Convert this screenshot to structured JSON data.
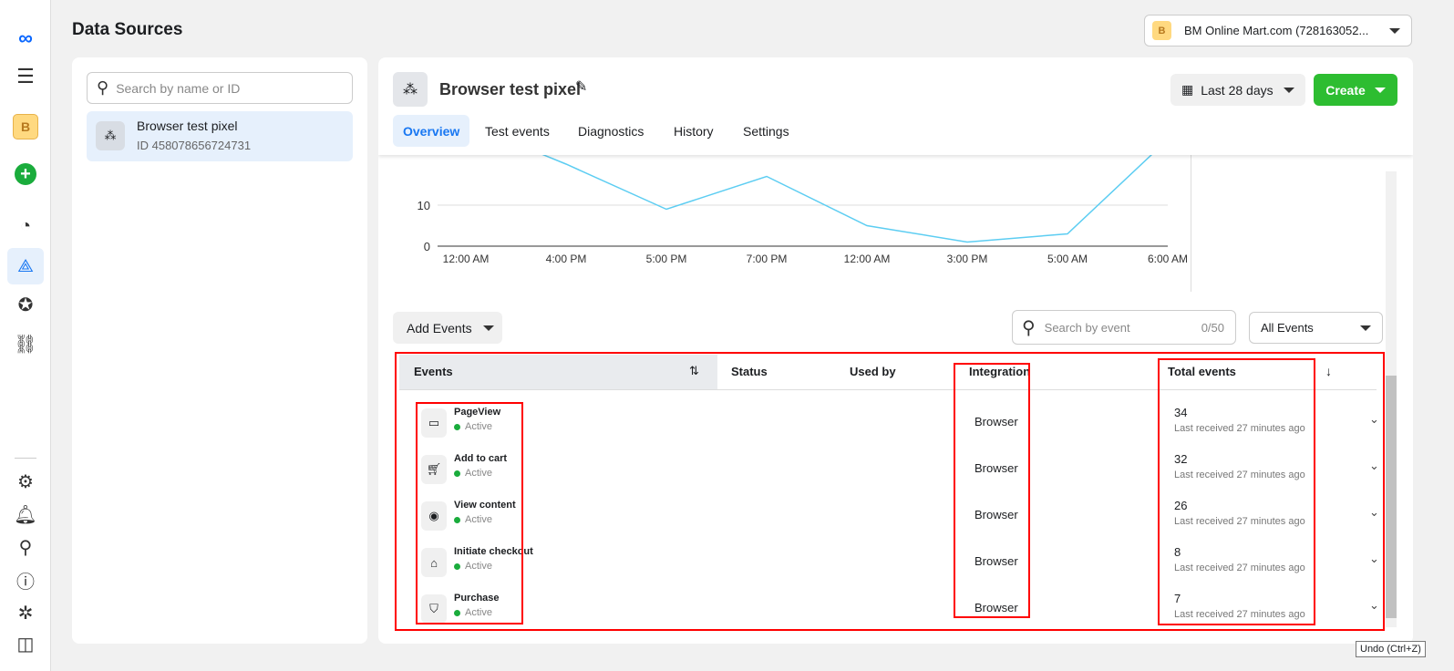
{
  "page": {
    "title": "Data Sources"
  },
  "account": {
    "initial": "B",
    "name": "BM Online Mart.com (728163052..."
  },
  "nav": {
    "items": [
      "menu-icon",
      "business-icon",
      "create-icon",
      "dashboard-icon",
      "events-manager-icon",
      "favorites-icon",
      "partner-icon",
      "settings-icon",
      "notifications-icon",
      "search-icon",
      "help-icon",
      "debug-icon",
      "sidebar-toggle-icon"
    ],
    "business_initial": "B"
  },
  "left": {
    "search_placeholder": "Search by name or ID",
    "pixel": {
      "name": "Browser test pixel",
      "id": "ID 458078656724731"
    }
  },
  "main": {
    "pixel_name": "Browser test pixel",
    "date_range": "Last 28 days",
    "create_label": "Create",
    "tabs": [
      {
        "label": "Overview",
        "active": true
      },
      {
        "label": "Test events"
      },
      {
        "label": "Diagnostics"
      },
      {
        "label": "History"
      },
      {
        "label": "Settings"
      }
    ]
  },
  "chart_data": {
    "type": "line",
    "categories": [
      "12:00 AM",
      "4:00 PM",
      "5:00 PM",
      "7:00 PM",
      "12:00 AM",
      "3:00 PM",
      "5:00 AM",
      "6:00 AM"
    ],
    "values": [
      30,
      20,
      9,
      17,
      5,
      1,
      3,
      26
    ],
    "yticks": [
      "0",
      "10"
    ],
    "color": "#5ccdf2"
  },
  "events_toolbar": {
    "add_events": "Add Events",
    "search_placeholder": "Search by event",
    "search_count": "0/50",
    "filter": "All Events"
  },
  "table": {
    "headers": {
      "events": "Events",
      "status": "Status",
      "used_by": "Used by",
      "integration": "Integration",
      "total": "Total events"
    },
    "rows": [
      {
        "name": "PageView",
        "status": "Active",
        "icon": "browser-window-icon",
        "integration": "Browser",
        "total": "34",
        "last": "Last received 27 minutes ago"
      },
      {
        "name": "Add to cart",
        "status": "Active",
        "icon": "cart-icon",
        "integration": "Browser",
        "total": "32",
        "last": "Last received 27 minutes ago"
      },
      {
        "name": "View content",
        "status": "Active",
        "icon": "eye-icon",
        "integration": "Browser",
        "total": "26",
        "last": "Last received 27 minutes ago"
      },
      {
        "name": "Initiate checkout",
        "status": "Active",
        "icon": "basket-icon",
        "integration": "Browser",
        "total": "8",
        "last": "Last received 27 minutes ago"
      },
      {
        "name": "Purchase",
        "status": "Active",
        "icon": "shopping-bag-icon",
        "integration": "Browser",
        "total": "7",
        "last": "Last received 27 minutes ago"
      }
    ]
  },
  "tooltip": "Undo (Ctrl+Z)"
}
